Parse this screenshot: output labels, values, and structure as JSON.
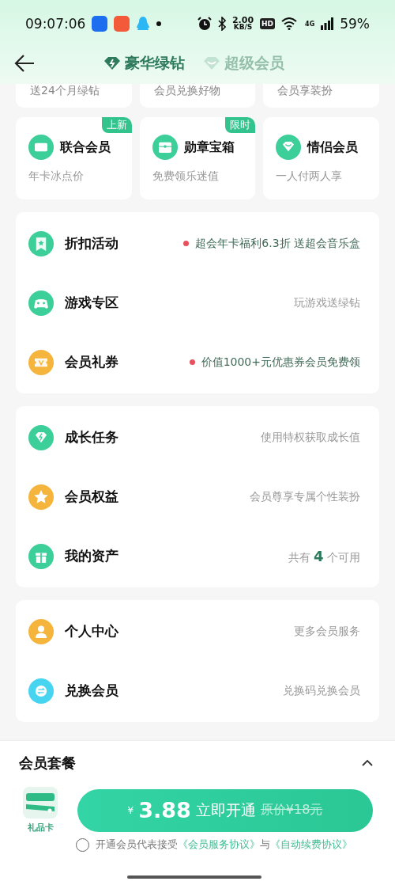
{
  "status_bar": {
    "time": "09:07:06",
    "speed": "2.00",
    "speed_unit": "KB/S",
    "hd": "HD",
    "network": "4G",
    "battery": "59%"
  },
  "header": {
    "tabs": [
      {
        "label": "豪华绿钻",
        "selected": true
      },
      {
        "label": "超级会员",
        "selected": false
      }
    ]
  },
  "top_cards": [
    {
      "subtitle": "送24个月绿钻"
    },
    {
      "subtitle": "会员兑换好物"
    },
    {
      "subtitle": "会员享装扮"
    }
  ],
  "feature_cards": [
    {
      "title": "联合会员",
      "subtitle": "年卡冰点价",
      "badge": "上新"
    },
    {
      "title": "勋章宝箱",
      "subtitle": "免费领乐迷值",
      "badge": "限时"
    },
    {
      "title": "情侣会员",
      "subtitle": "一人付两人享"
    }
  ],
  "sections": [
    {
      "rows": [
        {
          "label": "折扣活动",
          "hint": "超会年卡福利6.3折 送超会音乐盒",
          "dot": true,
          "color": "#3ccf9a"
        },
        {
          "label": "游戏专区",
          "hint": "玩游戏送绿钻",
          "dot": false,
          "color": "#3ccf9a"
        },
        {
          "label": "会员礼券",
          "hint": "价值1000+元优惠券会员免费领",
          "dot": true,
          "color": "#f5b43c"
        }
      ]
    },
    {
      "rows": [
        {
          "label": "成长任务",
          "hint": "使用特权获取成长值",
          "dot": false,
          "color": "#3ccf9a"
        },
        {
          "label": "会员权益",
          "hint": "会员尊享专属个性装扮",
          "dot": false,
          "color": "#f5b43c"
        },
        {
          "label": "我的资产",
          "hint": "共有 **4** 个可用",
          "dot": false,
          "color": "#3ccf9a"
        }
      ]
    },
    {
      "rows": [
        {
          "label": "个人中心",
          "hint": "更多会员服务",
          "dot": false,
          "color": "#f5b43c"
        },
        {
          "label": "兑换会员",
          "hint": "兑换码兑换会员",
          "dot": false,
          "color": "#46d4f0"
        }
      ]
    }
  ],
  "package": {
    "title": "会员套餐",
    "expanded": true,
    "gift_card": "礼品卡",
    "button": {
      "currency": "¥",
      "price": "3.88",
      "action": "立即开通",
      "original": "原价¥18元"
    },
    "agreement": {
      "checked": false,
      "text": "开通会员代表接受",
      "link_1": "《会员服务协议》",
      "joiner": "与",
      "link_2": "《自动续费协议》"
    }
  }
}
